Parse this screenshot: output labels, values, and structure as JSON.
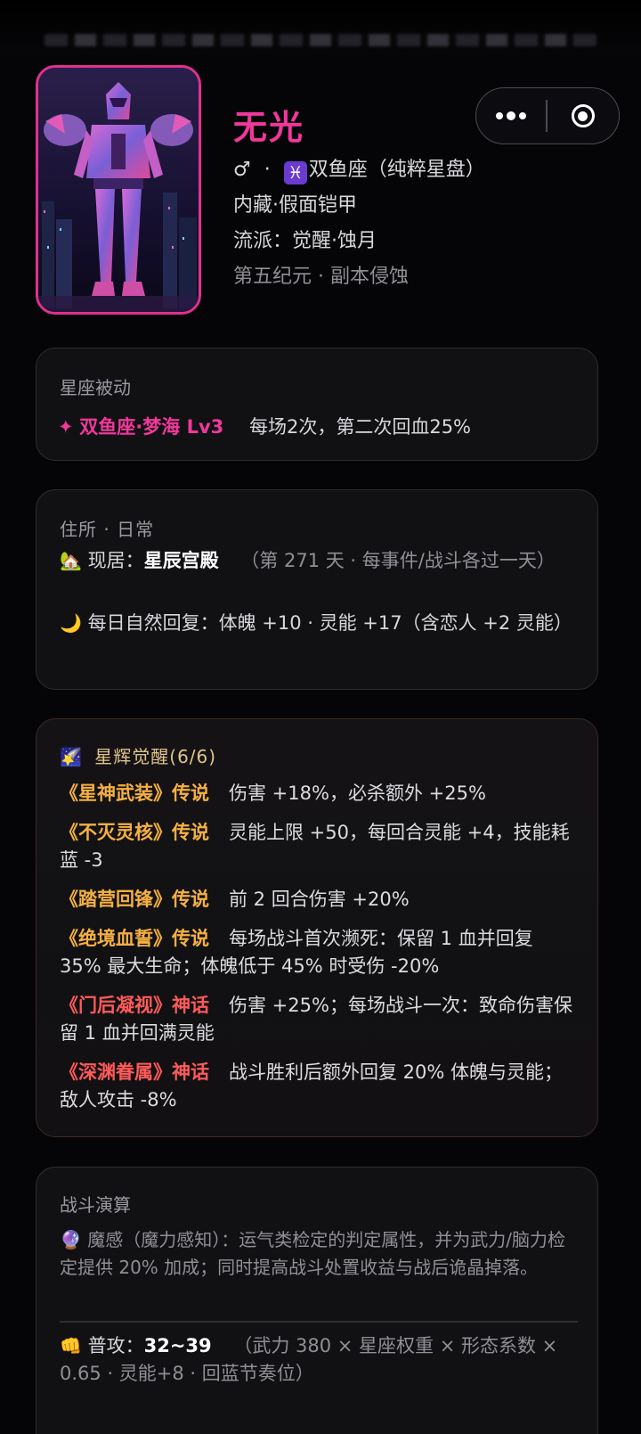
{
  "header": {
    "blurred_text": "丰堆宽馆餐门作币…",
    "menu_icon": "more-dots-icon",
    "close_icon": "target-icon"
  },
  "profile": {
    "name": "无光",
    "gender_symbol": "♂",
    "dot": "·",
    "sign_glyph": "♓",
    "sign_text": "双鱼座（纯粹星盘）",
    "build": "内藏·假面铠甲",
    "school": "流派：觉醒·蚀月",
    "era": "第五纪元 · 副本侵蚀"
  },
  "passive": {
    "title": "星座被动",
    "icon": "✦",
    "name": "双鱼座·梦海 Lv3",
    "desc": "每场2次，第二次回血25%"
  },
  "home": {
    "title": "住所 · 日常",
    "house_emoji": "🏡",
    "residence_label": "现居：",
    "residence_value": "星辰宫殿",
    "residence_note": "（第 271 天 · 每事件/战斗各过一天）",
    "moon_emoji": "🌙",
    "regen": "每日自然回复：体魄 +10 · 灵能 +17（含恋人 +2 灵能）"
  },
  "awakening": {
    "emoji": "🌠",
    "title": "星辉觉醒(6/6)",
    "items": [
      {
        "name": "《星神武装》传说",
        "desc": "伤害 +18%，必杀额外 +25%"
      },
      {
        "name": "《不灭灵核》传说",
        "desc": "灵能上限 +50，每回合灵能 +4，技能耗蓝 -3"
      },
      {
        "name": "《踏营回锋》传说",
        "desc": "前 2 回合伤害 +20%"
      },
      {
        "name": "《绝境血誓》传说",
        "desc": "每场战斗首次濒死：保留 1 血并回复 35% 最大生命；体魄低于 45% 时受伤 -20%"
      },
      {
        "name": "《门后凝视》神话",
        "desc": "伤害 +25%；每场战斗一次：致命伤害保留 1 血并回满灵能"
      },
      {
        "name": "《深渊眷属》神话",
        "desc": "战斗胜利后额外回复 20% 体魄与灵能；敌人攻击 -8%"
      }
    ]
  },
  "battle": {
    "title": "战斗演算",
    "crystal_emoji": "🔮",
    "desc": "魔感（魔力感知）：运气类检定的判定属性，并为武力/脑力检定提供 20% 加成；同时提高战斗处置收益与战后诡晶掉落。",
    "fist_emoji": "👊",
    "attack_label": "普攻：",
    "attack_value": "32~39",
    "attack_formula": "（武力 380 × 星座权重 × 形态系数 × 0.65 · 灵能+8 · 回蓝节奏位）"
  },
  "colors": {
    "accent_pink": "#f0389b",
    "legend_gold": "#f5b042",
    "myth_red": "#ff5a5a",
    "awake_title": "#e0c48a"
  }
}
